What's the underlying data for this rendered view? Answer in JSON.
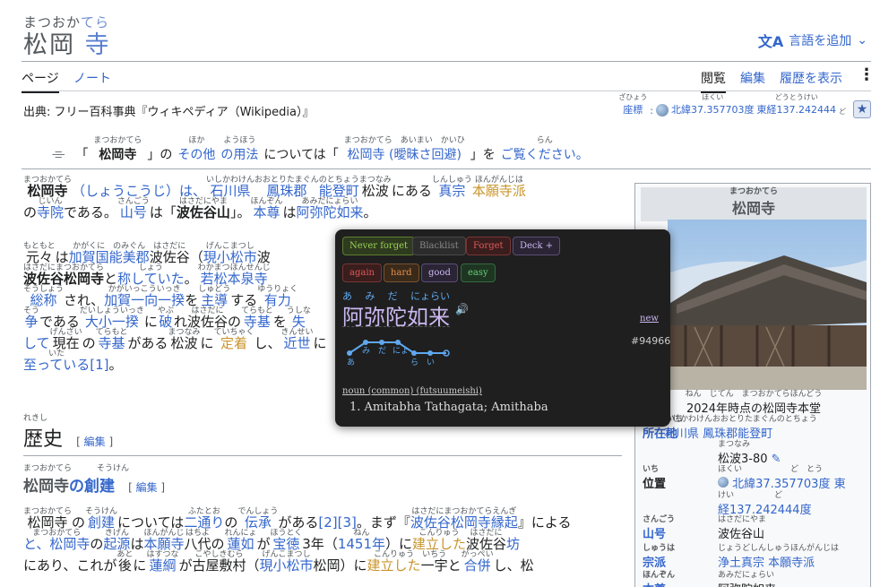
{
  "title": {
    "ruby_main": "まつおか",
    "ruby_tera": "てら",
    "main": "松岡",
    "tera": "寺"
  },
  "header": {
    "lang_icon": "文A",
    "lang_label": "言語を追加",
    "lang_chevron": "⌄"
  },
  "tabs": {
    "page": "ページ",
    "note": "ノート",
    "read": "閲覧",
    "edit": "編集",
    "history": "履歴を表示",
    "more": "⋮"
  },
  "source": "出典: フリー百科事典『ウィキペディア（Wikipedia）』",
  "coords": {
    "label_ruby": "ざひょう",
    "label": "座標",
    "colon": ":",
    "lat_ruby": "ほくい",
    "lat": "北緯37.357703度",
    "lon_ruby": "どうとうけい",
    "lon": "東経137.242444",
    "extra_ruby": "ど"
  },
  "hatnote": {
    "q1": "「",
    "name_ruby": "まつおかてら",
    "name": "松岡寺",
    "q2": "」の",
    "other_ruby": "ほか",
    "other": "その他",
    "usage_ruby": "ようほう",
    "usage": "の用法",
    "mid": "については「",
    "link_ruby": "まつおかてら　あいまい　かいひ",
    "link": "松岡寺 (曖昧さ回避)",
    "end": "」を",
    "see_ruby": "らん",
    "see": "ご覧ください。"
  },
  "para1": {
    "l1": [
      {
        "t": "松岡寺",
        "r": "まつおかてら",
        "c": "bold"
      },
      {
        "t": "（しょうこうじ）は、",
        "c": "link"
      },
      {
        "t": "石川県",
        "r": "いしかわけん",
        "c": "link"
      },
      {
        "t": "鳳珠郡",
        "r": "おおとりたまぐん",
        "c": "link"
      },
      {
        "t": "能登町",
        "r": "のとちょう",
        "c": "link"
      },
      {
        "t": "松波",
        "r": "まつなみ"
      },
      {
        "t": "にある"
      },
      {
        "t": "真宗",
        "r": "しんしゅう",
        "c": "link"
      },
      {
        "t": "本願寺派",
        "r": "ほんがんじは",
        "c": "gold"
      }
    ],
    "l2": [
      {
        "t": "の"
      },
      {
        "t": "寺院",
        "r": "じいん",
        "c": "link"
      },
      {
        "t": "である。"
      },
      {
        "t": "山号",
        "r": "さんごう",
        "c": "link"
      },
      {
        "t": "は「"
      },
      {
        "t": "波佐谷山",
        "r": "はさだにやま",
        "c": "bold"
      },
      {
        "t": "」。"
      },
      {
        "t": "本尊",
        "r": "ほんぞん",
        "c": "link"
      },
      {
        "t": "は"
      },
      {
        "t": "阿弥陀如来",
        "r": "あみだにょらい",
        "c": "link"
      },
      {
        "t": "。"
      }
    ]
  },
  "para2": [
    [
      {
        "t": "元々",
        "r": "もともと"
      },
      {
        "t": "は"
      },
      {
        "t": "加賀国",
        "r": "かがくに",
        "c": "link"
      },
      {
        "t": "能美郡",
        "r": "のみぐん",
        "c": "link"
      },
      {
        "t": "波佐谷",
        "r": "はさだに"
      },
      {
        "t": "（"
      },
      {
        "t": "現小松市",
        "r": "げんこまつし",
        "c": "link"
      },
      {
        "t": "波"
      }
    ],
    [
      {
        "t": "波佐谷松岡寺",
        "r": "はさだにまつおかてら",
        "c": "bold"
      },
      {
        "t": "と"
      },
      {
        "t": "称していた",
        "r": "しょう",
        "c": "link"
      },
      {
        "t": "。"
      },
      {
        "t": "若松本泉寺",
        "r": "わかまつほんせんじ",
        "c": "link"
      }
    ],
    [
      {
        "t": "総称",
        "r": "そうしょう",
        "c": "link"
      },
      {
        "t": "され、"
      },
      {
        "t": "加賀一向一揆",
        "r": "かがいっこういっき",
        "c": "link"
      },
      {
        "t": "を"
      },
      {
        "t": "主導",
        "r": "しゅどう",
        "c": "link"
      },
      {
        "t": "する"
      },
      {
        "t": "有力",
        "r": "ゆうりょく",
        "c": "link"
      }
    ],
    [
      {
        "t": "争",
        "r": "そう",
        "c": "link"
      },
      {
        "t": "である"
      },
      {
        "t": "大小一揆",
        "r": "だいしょういっき",
        "c": "link"
      },
      {
        "t": "に"
      },
      {
        "t": "破",
        "r": "やぶ",
        "c": "link"
      },
      {
        "t": "れ"
      },
      {
        "t": "波佐谷",
        "r": "はさだに"
      },
      {
        "t": "の"
      },
      {
        "t": "寺基",
        "r": "てらもと",
        "c": "link"
      },
      {
        "t": "を"
      },
      {
        "t": "失",
        "r": "うしな",
        "c": "link"
      }
    ],
    [
      {
        "t": "して",
        "c": "link"
      },
      {
        "t": "現在",
        "r": "げんざい"
      },
      {
        "t": "の"
      },
      {
        "t": "寺基",
        "r": "てらもと",
        "c": "link"
      },
      {
        "t": "がある"
      },
      {
        "t": "松波",
        "r": "まつなみ"
      },
      {
        "t": "に"
      },
      {
        "t": "定着",
        "r": "ていちゃく",
        "c": "gold"
      },
      {
        "t": "し、"
      },
      {
        "t": "近世",
        "r": "きんせい",
        "c": "link"
      },
      {
        "t": "に"
      }
    ],
    [
      {
        "t": "至っている",
        "r": "いた",
        "c": "link"
      },
      {
        "t": "[1]",
        "c": "link"
      },
      {
        "t": "。"
      }
    ]
  ],
  "history_heading": {
    "ruby": "れきし",
    "text": "歴史",
    "edit": "編集"
  },
  "founding_heading": {
    "ruby1": "まつおかてら",
    "t1": "松岡寺",
    "no": "の",
    "ruby2": "そうけん",
    "t2": "創建",
    "edit": "編集"
  },
  "para3": [
    [
      {
        "t": "松岡寺",
        "r": "まつおかてら"
      },
      {
        "t": "の"
      },
      {
        "t": "創建",
        "r": "そうけん",
        "c": "link"
      },
      {
        "t": "については"
      },
      {
        "t": "二通り",
        "r": "ふたとお",
        "c": "link"
      },
      {
        "t": "の"
      },
      {
        "t": "伝承",
        "r": "でんしょう",
        "c": "link"
      },
      {
        "t": "がある"
      },
      {
        "t": "[2][3]",
        "c": "link"
      },
      {
        "t": "。まず『"
      },
      {
        "t": "波佐谷松岡寺縁起",
        "r": "はさだにまつおかてらえんぎ",
        "c": "link"
      },
      {
        "t": "』による"
      }
    ],
    [
      {
        "t": "と、松岡寺",
        "r": "まつおかてら",
        "c": "link"
      },
      {
        "t": "の"
      },
      {
        "t": "起源",
        "r": "きげん",
        "c": "link"
      },
      {
        "t": "は"
      },
      {
        "t": "本願寺",
        "r": "ほんがんじ",
        "c": "link"
      },
      {
        "t": "八代",
        "r": "はちよ"
      },
      {
        "t": "の"
      },
      {
        "t": "蓮如",
        "r": "れんにょ",
        "c": "link"
      },
      {
        "t": "が"
      },
      {
        "t": "宝徳",
        "r": "ほうとく",
        "c": "link"
      },
      {
        "t": "3年（"
      },
      {
        "t": "1451年",
        "r": "ねん",
        "c": "link"
      },
      {
        "t": "）に"
      },
      {
        "t": "建立した",
        "r": "こんりゅう",
        "c": "gold"
      },
      {
        "t": "波佐谷",
        "r": "はさだに"
      },
      {
        "t": "坊",
        "c": "link"
      }
    ],
    [
      {
        "t": "にあり、これが"
      },
      {
        "t": "後",
        "r": "あと"
      },
      {
        "t": "に"
      },
      {
        "t": "蓮綱",
        "r": "はすつな",
        "c": "link"
      },
      {
        "t": "が"
      },
      {
        "t": "古屋敷村",
        "r": "こやしきむら"
      },
      {
        "t": "（"
      },
      {
        "t": "現小松市",
        "r": "げんこまつし",
        "c": "link"
      },
      {
        "t": "松岡"
      },
      {
        "t": "）に"
      },
      {
        "t": "建立した",
        "r": "こんりゅう",
        "c": "gold"
      },
      {
        "t": "一宇",
        "r": "いちう"
      },
      {
        "t": "と"
      },
      {
        "t": "合併",
        "r": "がっぺい",
        "c": "link"
      },
      {
        "t": "し、松"
      }
    ]
  ],
  "infobox": {
    "title_ruby": "まつおかてら",
    "title": "松岡寺",
    "caption_ruby": "ねん　じてん　まつおかてらほんどう",
    "caption": "2024年時点の松岡寺本堂",
    "loc_label_ruby": "しょざいち",
    "loc_label": "所在地",
    "loc_ruby": "いしかわけんおおとりたまぐんのとちょう",
    "loc": "石川県 鳳珠郡能登町",
    "loc2_ruby": "まつなみ",
    "loc2": "松波3-80",
    "pos_label_ruby": "いち",
    "pos_label": "位置",
    "pos_ruby": "ほくい　　　　　　ど　とう",
    "pos": "北緯37.357703度 東",
    "pos2_ruby": "けい　　　　　ど",
    "pos2": "経137.242444度",
    "mount_label_ruby": "さんごう",
    "mount_label": "山号",
    "mount_ruby": "はさだにやま",
    "mount": "波佐谷山",
    "sect_label_ruby": "しゅうは",
    "sect_label": "宗派",
    "sect_ruby": "じょうどしんしゅうほんがんじは",
    "sect": "浄土真宗 本願寺派",
    "honzon_label_ruby": "ほんぞん",
    "honzon_label": "本尊",
    "honzon_ruby": "あみだにょらい",
    "honzon": "阿弥陀如来"
  },
  "popup": {
    "buttons": {
      "never": "Never forget",
      "blacklist": "Blacklist",
      "forget": "Forget",
      "deck": "Deck +",
      "again": "again",
      "hard": "hard",
      "good": "good",
      "easy": "easy"
    },
    "reading": [
      "あ",
      "み",
      "だ",
      "にょらい"
    ],
    "word": "阿弥陀如来",
    "speaker": "🔊",
    "new_label": "new",
    "id": "#94966",
    "pitch_labels": [
      "あ",
      "み",
      "だ",
      "にょ",
      "ら",
      "い"
    ],
    "pos": "noun (common) (futsuumeishi)",
    "gloss": "1. Amitabha Tathagata; Amithaba"
  }
}
